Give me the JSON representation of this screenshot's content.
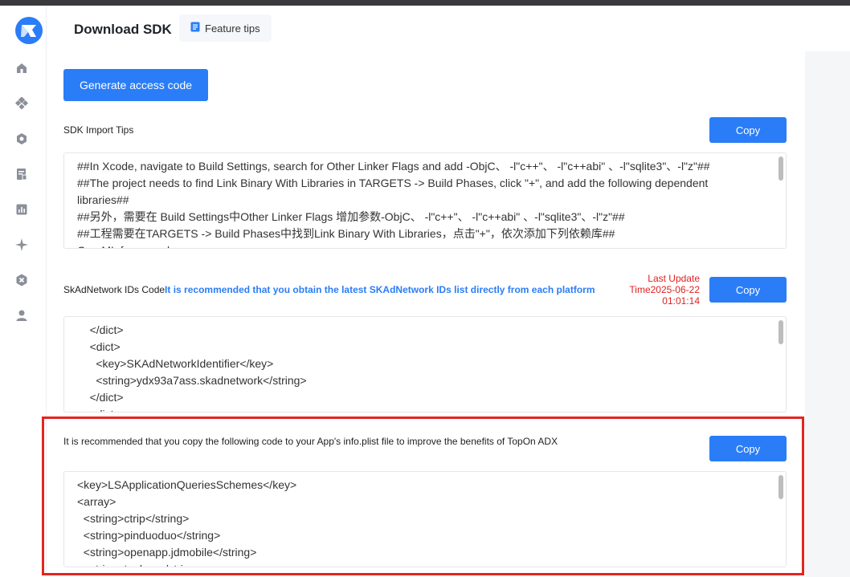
{
  "header": {
    "title": "Download SDK",
    "tips_label": "Feature tips"
  },
  "colors": {
    "accent": "#2a7df7",
    "warning": "#e02020",
    "highlight": "#e3251f"
  },
  "sidebar": {
    "items": [
      {
        "icon": "home-icon"
      },
      {
        "icon": "apps-icon"
      },
      {
        "icon": "settings-cluster-icon"
      },
      {
        "icon": "report-icon"
      },
      {
        "icon": "chart-icon"
      },
      {
        "icon": "sparkle-icon"
      },
      {
        "icon": "close-circle-icon"
      },
      {
        "icon": "user-icon"
      }
    ]
  },
  "main": {
    "generate_label": "Generate access code",
    "import_tips": {
      "label": "SDK Import Tips",
      "copy_label": "Copy",
      "code": "##In Xcode, navigate to Build Settings, search for Other Linker Flags and add -ObjC、 -l\"c++\"、 -l\"c++abi\" 、-l\"sqlite3\"、-l\"z\"##\n##The project needs to find Link Binary With Libraries in TARGETS -> Build Phases, click \"+\", and add the following dependent libraries##\n##另外，需要在 Build Settings中Other Linker Flags 增加参数-ObjC、 -l\"c++\"、 -l\"c++abi\" 、-l\"sqlite3\"、-l\"z\"##\n##工程需要在TARGETS -> Build Phases中找到Link Binary With Libraries，点击\"+\"，依次添加下列依赖库##\nCoreML.framework"
    },
    "skad": {
      "label": "SkAdNetwork IDs Code",
      "note": "It is recommended that you obtain the latest SKAdNetwork IDs list directly from each platform",
      "update_line1": "Last Update",
      "update_line2": "Time2025-06-22",
      "update_line3": "01:01:14",
      "copy_label": "Copy",
      "code": "    </dict>\n    <dict>\n      <key>SKAdNetworkIdentifier</key>\n      <string>ydx93a7ass.skadnetwork</string>\n    </dict>\n    <dict>"
    },
    "plist": {
      "label": "It is recommended that you copy the following code to your App's info.plist file to improve the benefits of TopOn ADX",
      "copy_label": "Copy",
      "code": "<key>LSApplicationQueriesSchemes</key>\n<array>\n  <string>ctrip</string>\n  <string>pinduoduo</string>\n  <string>openapp.jdmobile</string>\n  <string>taobao</string>"
    }
  }
}
